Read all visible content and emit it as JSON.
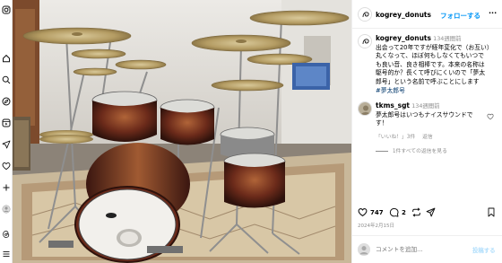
{
  "post": {
    "username": "kogrey_donuts",
    "follow_label": "フォローする",
    "more_label": "···",
    "caption_username": "kogrey_donuts",
    "caption_time": "134週間前",
    "caption_lines": [
      "出会って20年ですが経年変化で（お互い）",
      "丸くなって、ほぼ何もしなくてもいつで",
      "も良い音、良き相棒です。本来の名称は",
      "駆号的か？長くて呼びにくいので「夢太",
      "郎号」という名前で呼ぶことにします"
    ],
    "hashtag": "#夢太郎号",
    "likes": "747",
    "comments_count": "2",
    "date": "2024年2月15日"
  },
  "comment": {
    "username": "tkms_sgt",
    "time": "134週間前",
    "lines": [
      "夢太郎号はいつもナイスサウンドで",
      "す！"
    ],
    "likes_label": "「いいね！」3件",
    "reply_label": "返信",
    "view_replies": "1件すべての返信を見る"
  },
  "composer": {
    "placeholder": "コメントを追加...",
    "post_label": "投稿する"
  },
  "colors": {
    "accent": "#0095f6",
    "tag": "#00376b",
    "muted": "#8e8e8e"
  }
}
